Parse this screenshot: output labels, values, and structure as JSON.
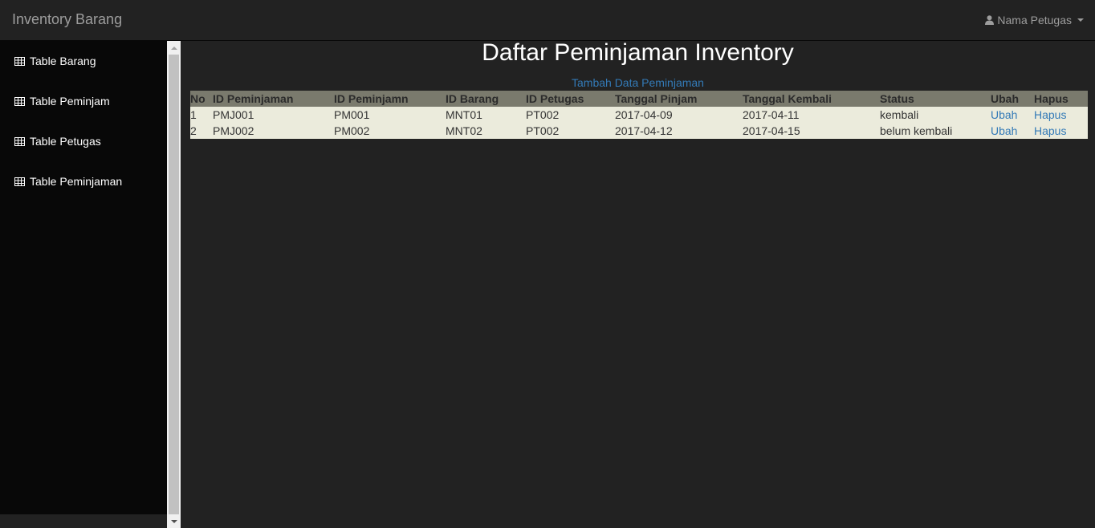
{
  "navbar": {
    "brand": "Inventory Barang",
    "user_label": "Nama Petugas"
  },
  "sidebar": {
    "items": [
      {
        "label": "Table Barang"
      },
      {
        "label": "Table Peminjam"
      },
      {
        "label": "Table Petugas"
      },
      {
        "label": "Table Peminjaman"
      }
    ]
  },
  "main": {
    "title": "Daftar Peminjaman Inventory",
    "add_link": "Tambah Data Peminjaman",
    "table": {
      "headers": [
        "No",
        "ID Peminjaman",
        "ID Peminjamn",
        "ID Barang",
        "ID Petugas",
        "Tanggal Pinjam",
        "Tanggal Kembali",
        "Status",
        "Ubah",
        "Hapus"
      ],
      "rows": [
        [
          "1",
          "PMJ001",
          "PM001",
          "MNT01",
          "PT002",
          "2017-04-09",
          "2017-04-11",
          "kembali",
          "Ubah",
          "Hapus"
        ],
        [
          "2",
          "PMJ002",
          "PM002",
          "MNT02",
          "PT002",
          "2017-04-12",
          "2017-04-15",
          "belum kembali",
          "Ubah",
          "Hapus"
        ]
      ]
    }
  },
  "icons": {
    "user": "user-icon",
    "table": "table-icon"
  },
  "colors": {
    "link": "#337ab7",
    "header_bg": "#7a7a6d",
    "row_bg": "#ebebdc"
  }
}
